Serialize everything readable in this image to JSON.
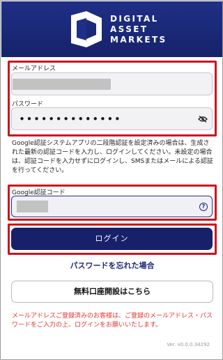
{
  "brand": {
    "line1": "DIGITAL",
    "line2": "ASSET",
    "line3": "MARKETS",
    "logo_icon": "dam-logo-icon",
    "header_color": "#1f2f86"
  },
  "form": {
    "email_label": "メールアドレス",
    "password_label": "パスワード",
    "password_value": "••••••••••••••",
    "google_code_label": "Google認証コード"
  },
  "info_text": "Google認証システムアプリの二段階認証を設定済みの場合は、生成された最新の認証コードを入力し、ログインしてください。未設定の場合は、認証コードを入力せずにログインし、SMSまたはメールによる認証を行ってください。",
  "buttons": {
    "login": "ログイン",
    "forgot_password": "パスワードを忘れた場合",
    "open_account": "無料口座開設はこちら"
  },
  "notice": "メールアドレスご登録済みのお客様は、ご登録のメールアドレス・パスワードをご入力の上、ログインをお願いいたします。",
  "version": "Ver. v0.0.0.34292",
  "colors": {
    "accent": "#19206a",
    "highlight": "#d0121b",
    "notice": "#e0352e"
  }
}
